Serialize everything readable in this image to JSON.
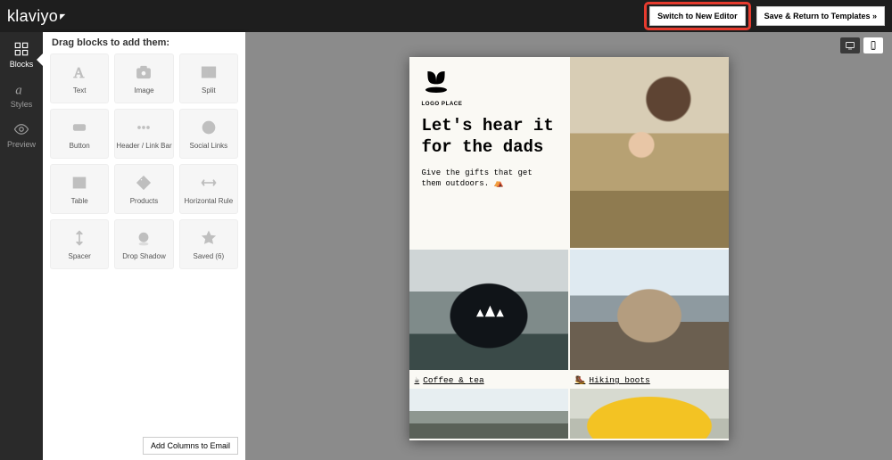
{
  "brand": "klaviyo",
  "topbar": {
    "switch_label": "Switch to New Editor",
    "save_label": "Save & Return to Templates »"
  },
  "rail": {
    "blocks": "Blocks",
    "styles": "Styles",
    "preview": "Preview"
  },
  "panel": {
    "title": "Drag blocks to add them:",
    "add_columns": "Add Columns to Email",
    "tiles": {
      "text": "Text",
      "image": "Image",
      "split": "Split",
      "button": "Button",
      "header": "Header / Link Bar",
      "social": "Social Links",
      "table": "Table",
      "products": "Products",
      "hr": "Horizontal Rule",
      "spacer": "Spacer",
      "shadow": "Drop Shadow",
      "saved": "Saved (6)"
    }
  },
  "email": {
    "logo_sub": "LOGO PLACE",
    "headline": "Let's hear it for the dads",
    "subcopy": "Give the gifts that get them outdoors. ⛺",
    "caption_coffee": "Coffee & tea",
    "caption_boots": "Hiking boots",
    "coffee_emoji": "☕",
    "boot_emoji": "🥾"
  }
}
